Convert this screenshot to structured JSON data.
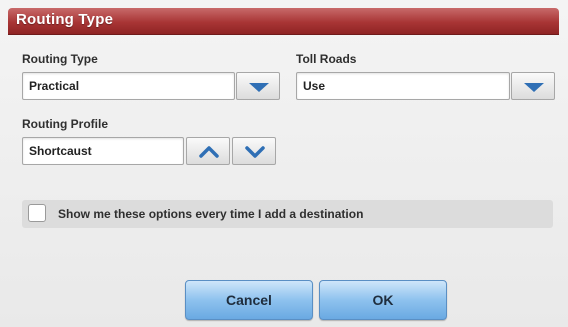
{
  "dialog": {
    "title": "Routing Type",
    "accent_color": "#a83535"
  },
  "routing_type": {
    "label": "Routing Type",
    "value": "Practical",
    "dropdown_icon": "triangle-down-icon"
  },
  "toll_roads": {
    "label": "Toll Roads",
    "value": "Use",
    "dropdown_icon": "triangle-down-icon"
  },
  "routing_profile": {
    "label": "Routing Profile",
    "value": "Shortcaust",
    "up_icon": "chevron-up-icon",
    "down_icon": "chevron-down-icon"
  },
  "options": {
    "checkbox_label": "Show me these options every time I add a destination",
    "checked": false
  },
  "buttons": {
    "cancel": "Cancel",
    "ok": "OK"
  }
}
